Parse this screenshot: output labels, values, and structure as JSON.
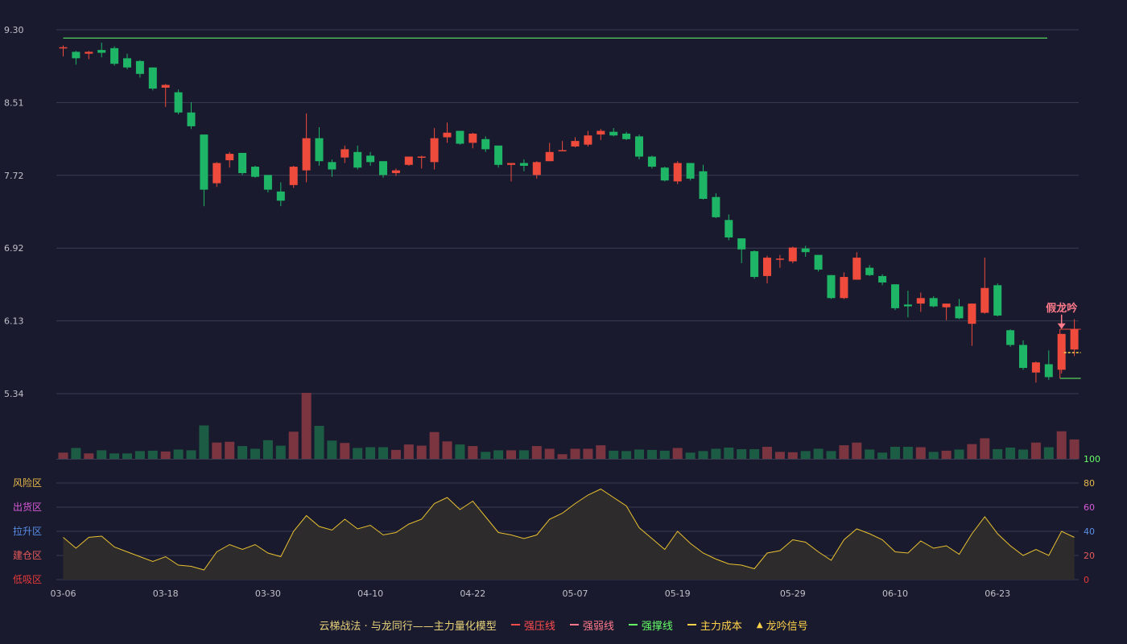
{
  "chart_data": {
    "type": "candlestick",
    "price_axis": {
      "ticks": [
        "9.30",
        "8.51",
        "7.72",
        "6.92",
        "6.13",
        "5.34"
      ],
      "ylim": [
        5.34,
        9.3
      ]
    },
    "date_labels": [
      "03-06",
      "03-18",
      "03-30",
      "04-10",
      "04-22",
      "05-07",
      "05-19",
      "05-29",
      "06-10",
      "06-23"
    ],
    "date_label_index": [
      0,
      8,
      16,
      24,
      32,
      40,
      48,
      57,
      65,
      73
    ],
    "candles": [
      [
        9.1,
        9.11,
        9.01,
        9.13
      ],
      [
        9.06,
        8.99,
        8.92,
        9.07
      ],
      [
        9.04,
        9.06,
        8.98,
        9.07
      ],
      [
        9.08,
        9.05,
        9.0,
        9.16
      ],
      [
        9.1,
        8.93,
        8.91,
        9.12
      ],
      [
        8.99,
        8.89,
        8.87,
        9.04
      ],
      [
        8.96,
        8.82,
        8.78,
        8.97
      ],
      [
        8.89,
        8.66,
        8.64,
        8.89
      ],
      [
        8.67,
        8.7,
        8.46,
        8.71
      ],
      [
        8.62,
        8.4,
        8.38,
        8.65
      ],
      [
        8.4,
        8.25,
        8.22,
        8.51
      ],
      [
        8.16,
        7.56,
        7.38,
        8.16
      ],
      [
        7.63,
        7.85,
        7.59,
        7.86
      ],
      [
        7.88,
        7.95,
        7.8,
        7.97
      ],
      [
        7.96,
        7.74,
        7.72,
        7.96
      ],
      [
        7.81,
        7.7,
        7.69,
        7.82
      ],
      [
        7.72,
        7.56,
        7.53,
        7.72
      ],
      [
        7.54,
        7.44,
        7.38,
        7.64
      ],
      [
        7.61,
        7.81,
        7.58,
        7.82
      ],
      [
        7.77,
        8.12,
        7.64,
        8.39
      ],
      [
        8.12,
        7.87,
        7.82,
        8.24
      ],
      [
        7.86,
        7.78,
        7.7,
        7.89
      ],
      [
        7.91,
        8.0,
        7.85,
        8.04
      ],
      [
        7.97,
        7.8,
        7.78,
        8.04
      ],
      [
        7.93,
        7.86,
        7.82,
        7.97
      ],
      [
        7.87,
        7.72,
        7.69,
        7.87
      ],
      [
        7.74,
        7.77,
        7.71,
        7.79
      ],
      [
        7.83,
        7.92,
        7.82,
        7.92
      ],
      [
        7.91,
        7.92,
        7.79,
        7.93
      ],
      [
        7.86,
        8.12,
        7.78,
        8.23
      ],
      [
        8.13,
        8.18,
        8.07,
        8.29
      ],
      [
        8.2,
        8.06,
        8.05,
        8.2
      ],
      [
        8.07,
        8.17,
        8.01,
        8.18
      ],
      [
        8.11,
        8.0,
        7.97,
        8.14
      ],
      [
        8.04,
        7.83,
        7.8,
        8.04
      ],
      [
        7.83,
        7.85,
        7.65,
        7.85
      ],
      [
        7.85,
        7.82,
        7.76,
        7.89
      ],
      [
        7.72,
        7.86,
        7.68,
        7.87
      ],
      [
        7.87,
        7.97,
        7.87,
        8.07
      ],
      [
        7.99,
        7.99,
        7.98,
        8.09
      ],
      [
        8.03,
        8.09,
        8.02,
        8.13
      ],
      [
        8.05,
        8.15,
        8.03,
        8.2
      ],
      [
        8.16,
        8.2,
        8.1,
        8.22
      ],
      [
        8.19,
        8.15,
        8.14,
        8.23
      ],
      [
        8.17,
        8.11,
        8.1,
        8.19
      ],
      [
        8.14,
        7.92,
        7.89,
        8.16
      ],
      [
        7.92,
        7.81,
        7.79,
        7.93
      ],
      [
        7.8,
        7.66,
        7.65,
        7.81
      ],
      [
        7.65,
        7.85,
        7.62,
        7.87
      ],
      [
        7.85,
        7.68,
        7.66,
        7.85
      ],
      [
        7.76,
        7.46,
        7.45,
        7.83
      ],
      [
        7.48,
        7.26,
        7.25,
        7.52
      ],
      [
        7.23,
        7.04,
        7.01,
        7.29
      ],
      [
        7.03,
        6.91,
        6.76,
        7.03
      ],
      [
        6.89,
        6.61,
        6.59,
        6.9
      ],
      [
        6.62,
        6.82,
        6.54,
        6.84
      ],
      [
        6.8,
        6.81,
        6.71,
        6.85
      ],
      [
        6.78,
        6.93,
        6.76,
        6.94
      ],
      [
        6.92,
        6.88,
        6.83,
        6.95
      ],
      [
        6.85,
        6.69,
        6.67,
        6.85
      ],
      [
        6.63,
        6.38,
        6.37,
        6.63
      ],
      [
        6.38,
        6.61,
        6.37,
        6.66
      ],
      [
        6.58,
        6.82,
        6.58,
        6.88
      ],
      [
        6.71,
        6.63,
        6.62,
        6.74
      ],
      [
        6.62,
        6.55,
        6.52,
        6.64
      ],
      [
        6.53,
        6.27,
        6.25,
        6.53
      ],
      [
        6.31,
        6.29,
        6.17,
        6.46
      ],
      [
        6.32,
        6.38,
        6.23,
        6.44
      ],
      [
        6.38,
        6.29,
        6.28,
        6.4
      ],
      [
        6.28,
        6.32,
        6.14,
        6.32
      ],
      [
        6.29,
        6.16,
        6.15,
        6.37
      ],
      [
        6.1,
        6.32,
        5.86,
        6.32
      ],
      [
        6.22,
        6.49,
        6.21,
        6.82
      ],
      [
        6.52,
        6.19,
        6.18,
        6.54
      ],
      [
        6.03,
        5.87,
        5.85,
        6.04
      ],
      [
        5.87,
        5.62,
        5.6,
        5.92
      ],
      [
        5.57,
        5.68,
        5.46,
        5.69
      ],
      [
        5.66,
        5.52,
        5.49,
        5.81
      ],
      [
        5.6,
        5.99,
        5.56,
        5.99
      ],
      [
        5.82,
        6.04,
        5.75,
        6.15
      ]
    ],
    "volume": [
      16,
      28,
      14,
      22,
      14,
      14,
      20,
      21,
      19,
      24,
      22,
      86,
      42,
      44,
      33,
      26,
      48,
      34,
      70,
      170,
      85,
      47,
      41,
      28,
      30,
      30,
      23,
      37,
      34,
      69,
      45,
      37,
      33,
      18,
      22,
      22,
      22,
      33,
      26,
      12,
      26,
      26,
      35,
      21,
      20,
      24,
      23,
      21,
      28,
      16,
      20,
      26,
      29,
      25,
      25,
      31,
      18,
      17,
      20,
      26,
      20,
      35,
      42,
      24,
      16,
      31,
      31,
      30,
      18,
      21,
      24,
      38,
      53,
      25,
      29,
      24,
      42,
      30,
      71,
      50
    ],
    "oscillator": {
      "values": [
        35,
        26,
        35,
        36,
        27,
        23,
        19,
        15,
        19,
        12,
        11,
        8,
        23,
        29,
        25,
        29,
        22,
        19,
        40,
        53,
        44,
        41,
        50,
        42,
        45,
        37,
        39,
        46,
        50,
        63,
        68,
        58,
        65,
        52,
        39,
        37,
        34,
        37,
        50,
        55,
        63,
        70,
        75,
        68,
        61,
        43,
        34,
        25,
        40,
        30,
        22,
        17,
        13,
        12,
        9,
        22,
        24,
        33,
        31,
        23,
        16,
        33,
        42,
        38,
        33,
        23,
        22,
        32,
        26,
        28,
        21,
        38,
        52,
        38,
        28,
        20,
        25,
        20,
        40,
        35
      ],
      "axis_ticks": [
        "100",
        "80",
        "60",
        "40",
        "20",
        "0"
      ],
      "ylim": [
        0,
        100
      ],
      "zones": [
        {
          "label": "风险区",
          "color": "#e8b84a"
        },
        {
          "label": "出货区",
          "color": "#d85ad8"
        },
        {
          "label": "拉升区",
          "color": "#5a8ee8"
        },
        {
          "label": "建仓区",
          "color": "#e85a5a"
        },
        {
          "label": "低吸区",
          "color": "#e83a3a"
        }
      ]
    },
    "resistance_line": {
      "value": 9.21
    },
    "annotation": {
      "text": "假龙吟",
      "index": 78
    },
    "legend": [
      {
        "label": "云梯战法 · 与龙同行——主力量化模型",
        "color": "#e8d27a",
        "marker": "none"
      },
      {
        "label": "强压线",
        "color": "#ff4d4d",
        "marker": "solid"
      },
      {
        "label": "强弱线",
        "color": "#ff7a8a",
        "marker": "dashed"
      },
      {
        "label": "强撑线",
        "color": "#66ff66",
        "marker": "solid"
      },
      {
        "label": "主力成本",
        "color": "#ffd24a",
        "marker": "dashed"
      },
      {
        "label": "龙吟信号",
        "color": "#ffd24a",
        "marker": "triangle"
      }
    ]
  },
  "colors": {
    "background": "#191a2e",
    "up": "#ee4b3c",
    "down": "#1fb566",
    "up_volume": "#7a3540",
    "down_volume": "#1d5c44",
    "grid": "#3a3c52",
    "axis_text": "#c0c0c8",
    "oscillator_line": "#e8c030",
    "oscillator_fill": "#2e2b2c",
    "support": "#66ff66",
    "annotation": "#ff7a8a",
    "cost": "#ffd24a"
  }
}
